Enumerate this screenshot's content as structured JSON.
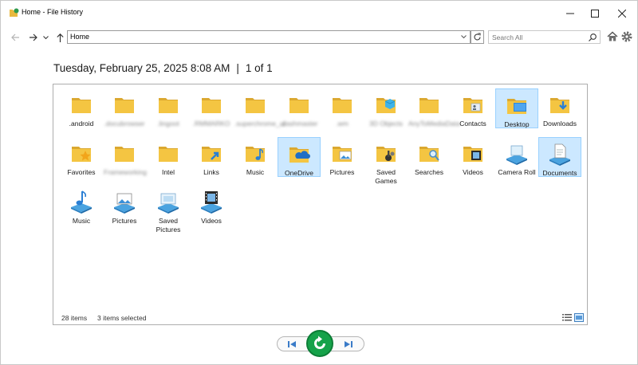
{
  "window": {
    "title": "Home - File History",
    "minimize_icon": "minimize-icon",
    "maximize_icon": "maximize-icon",
    "close_icon": "close-icon"
  },
  "nav": {
    "address": "Home",
    "search_placeholder": "Search All"
  },
  "header": {
    "datetime": "Tuesday, February 25, 2025 8:08 AM",
    "separator": "|",
    "position": "1 of 1"
  },
  "items": [
    {
      "label": ".android",
      "icon": "folder",
      "selected": false,
      "blurred": false
    },
    {
      "label": ".docubrowser",
      "icon": "folder",
      "selected": false,
      "blurred": true
    },
    {
      "label": ".lingoot",
      "icon": "folder",
      "selected": false,
      "blurred": true
    },
    {
      "label": ".RMMARKO",
      "icon": "folder",
      "selected": false,
      "blurred": true
    },
    {
      "label": ".superchrome_ui",
      "icon": "folder",
      "selected": false,
      "blurred": true
    },
    {
      "label": ".dashmaster",
      "icon": "folder",
      "selected": false,
      "blurred": true
    },
    {
      "label": ".wm",
      "icon": "folder",
      "selected": false,
      "blurred": true
    },
    {
      "label": "3D Objects",
      "icon": "folder-3d",
      "selected": false,
      "blurred": true
    },
    {
      "label": "AnyToMediaData",
      "icon": "folder",
      "selected": false,
      "blurred": true
    },
    {
      "label": "Contacts",
      "icon": "folder-contacts",
      "selected": false,
      "blurred": false
    },
    {
      "label": "Desktop",
      "icon": "folder-desktop",
      "selected": true,
      "blurred": false
    },
    {
      "label": "Downloads",
      "icon": "folder-downloads",
      "selected": false,
      "blurred": false
    },
    {
      "label": "Favorites",
      "icon": "folder-star",
      "selected": false,
      "blurred": false
    },
    {
      "label": "Frameworking",
      "icon": "folder",
      "selected": false,
      "blurred": true
    },
    {
      "label": "Intel",
      "icon": "folder",
      "selected": false,
      "blurred": false
    },
    {
      "label": "Links",
      "icon": "folder-links",
      "selected": false,
      "blurred": false
    },
    {
      "label": "Music",
      "icon": "folder-music",
      "selected": false,
      "blurred": false
    },
    {
      "label": "OneDrive",
      "icon": "folder-onedrive",
      "selected": true,
      "blurred": false
    },
    {
      "label": "Pictures",
      "icon": "folder-pictures",
      "selected": false,
      "blurred": false
    },
    {
      "label": "Saved Games",
      "icon": "folder-games",
      "selected": false,
      "blurred": false
    },
    {
      "label": "Searches",
      "icon": "folder-search",
      "selected": false,
      "blurred": false
    },
    {
      "label": "Videos",
      "icon": "folder-videos",
      "selected": false,
      "blurred": false
    },
    {
      "label": "Camera Roll",
      "icon": "library-camera",
      "selected": false,
      "blurred": false
    },
    {
      "label": "Documents",
      "icon": "library-documents",
      "selected": true,
      "blurred": false
    },
    {
      "label": "Music",
      "icon": "library-music",
      "selected": false,
      "blurred": false
    },
    {
      "label": "Pictures",
      "icon": "library-pictures",
      "selected": false,
      "blurred": false
    },
    {
      "label": "Saved Pictures",
      "icon": "library-saved-pictures",
      "selected": false,
      "blurred": false
    },
    {
      "label": "Videos",
      "icon": "library-videos",
      "selected": false,
      "blurred": false
    }
  ],
  "status": {
    "count": "28 items",
    "selected": "3 items selected"
  },
  "controls": {
    "previous_icon": "skip-previous-icon",
    "restore_icon": "restore-icon",
    "next_icon": "skip-next-icon"
  },
  "colors": {
    "folder": "#f4c542",
    "folder_dark": "#dba830",
    "selection": "#cce8ff",
    "restore_green": "#15a24a"
  }
}
